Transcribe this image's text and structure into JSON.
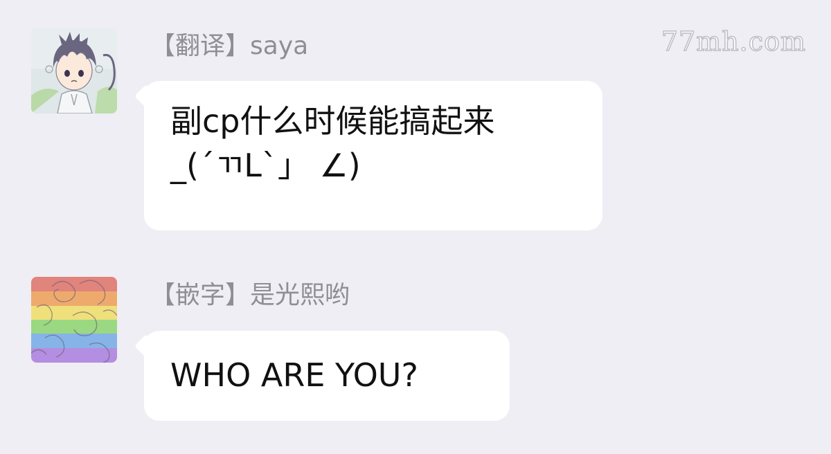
{
  "watermark": "77mh.com",
  "messages": [
    {
      "sender": "【翻译】saya",
      "avatar_icon": "anime-boy-avatar-icon",
      "lines": [
        "副cp什么时候能搞起来",
        "_(´ㄲL`」 ∠)"
      ]
    },
    {
      "sender": "【嵌字】是光熙哟",
      "avatar_icon": "rainbow-roses-avatar-icon",
      "lines": [
        "WHO ARE YOU?"
      ]
    }
  ],
  "colors": {
    "background": "#efeef4",
    "bubble": "#ffffff",
    "sender_text": "#8e8e93",
    "message_text": "#111111"
  }
}
